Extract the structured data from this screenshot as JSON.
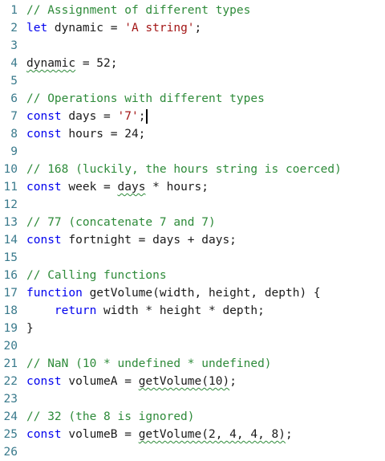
{
  "editor": {
    "language": "javascript",
    "colors": {
      "comment": "#2e8b3a",
      "keyword": "#0000ee",
      "string": "#a31515",
      "plain": "#1a1a1a",
      "line_number": "#3a7a8c"
    },
    "lines": [
      {
        "n": "1",
        "tokens": [
          {
            "t": "// Assignment of different types",
            "c": "comment"
          }
        ]
      },
      {
        "n": "2",
        "tokens": [
          {
            "t": "let",
            "c": "keyword"
          },
          {
            "t": " dynamic = ",
            "c": "plain"
          },
          {
            "t": "'A string'",
            "c": "string"
          },
          {
            "t": ";",
            "c": "plain"
          }
        ]
      },
      {
        "n": "3",
        "tokens": []
      },
      {
        "n": "4",
        "tokens": [
          {
            "t": "dynamic",
            "c": "plain",
            "squiggle": true
          },
          {
            "t": " = 52;",
            "c": "plain"
          }
        ]
      },
      {
        "n": "5",
        "tokens": []
      },
      {
        "n": "6",
        "tokens": [
          {
            "t": "// Operations with different types",
            "c": "comment"
          }
        ]
      },
      {
        "n": "7",
        "tokens": [
          {
            "t": "const",
            "c": "keyword"
          },
          {
            "t": " days = ",
            "c": "plain"
          },
          {
            "t": "'7'",
            "c": "string"
          },
          {
            "t": ";",
            "c": "plain"
          }
        ],
        "caret": true
      },
      {
        "n": "8",
        "tokens": [
          {
            "t": "const",
            "c": "keyword"
          },
          {
            "t": " hours = 24;",
            "c": "plain"
          }
        ]
      },
      {
        "n": "9",
        "tokens": []
      },
      {
        "n": "10",
        "tokens": [
          {
            "t": "// 168 (luckily, the hours string is coerced)",
            "c": "comment"
          }
        ]
      },
      {
        "n": "11",
        "tokens": [
          {
            "t": "const",
            "c": "keyword"
          },
          {
            "t": " week = ",
            "c": "plain"
          },
          {
            "t": "days",
            "c": "plain",
            "squiggle": true
          },
          {
            "t": " * hours;",
            "c": "plain"
          }
        ]
      },
      {
        "n": "12",
        "tokens": []
      },
      {
        "n": "13",
        "tokens": [
          {
            "t": "// 77 (concatenate 7 and 7)",
            "c": "comment"
          }
        ]
      },
      {
        "n": "14",
        "tokens": [
          {
            "t": "const",
            "c": "keyword"
          },
          {
            "t": " fortnight = days + days;",
            "c": "plain"
          }
        ]
      },
      {
        "n": "15",
        "tokens": []
      },
      {
        "n": "16",
        "tokens": [
          {
            "t": "// Calling functions",
            "c": "comment"
          }
        ]
      },
      {
        "n": "17",
        "tokens": [
          {
            "t": "function",
            "c": "keyword"
          },
          {
            "t": " getVolume(width, height, depth) {",
            "c": "plain"
          }
        ]
      },
      {
        "n": "18",
        "tokens": [
          {
            "t": "    ",
            "c": "plain"
          },
          {
            "t": "return",
            "c": "keyword"
          },
          {
            "t": " width * height * depth;",
            "c": "plain"
          }
        ]
      },
      {
        "n": "19",
        "tokens": [
          {
            "t": "}",
            "c": "plain"
          }
        ]
      },
      {
        "n": "20",
        "tokens": []
      },
      {
        "n": "21",
        "tokens": [
          {
            "t": "// NaN (10 * undefined * undefined)",
            "c": "comment"
          }
        ]
      },
      {
        "n": "22",
        "tokens": [
          {
            "t": "const",
            "c": "keyword"
          },
          {
            "t": " volumeA = ",
            "c": "plain"
          },
          {
            "t": "getVolume(10)",
            "c": "plain",
            "squiggle": true
          },
          {
            "t": ";",
            "c": "plain"
          }
        ]
      },
      {
        "n": "23",
        "tokens": []
      },
      {
        "n": "24",
        "tokens": [
          {
            "t": "// 32 (the 8 is ignored)",
            "c": "comment"
          }
        ]
      },
      {
        "n": "25",
        "tokens": [
          {
            "t": "const",
            "c": "keyword"
          },
          {
            "t": " volumeB = ",
            "c": "plain"
          },
          {
            "t": "getVolume(2, 4, 4, 8)",
            "c": "plain",
            "squiggle": true
          },
          {
            "t": ";",
            "c": "plain"
          }
        ]
      },
      {
        "n": "26",
        "tokens": []
      }
    ]
  }
}
